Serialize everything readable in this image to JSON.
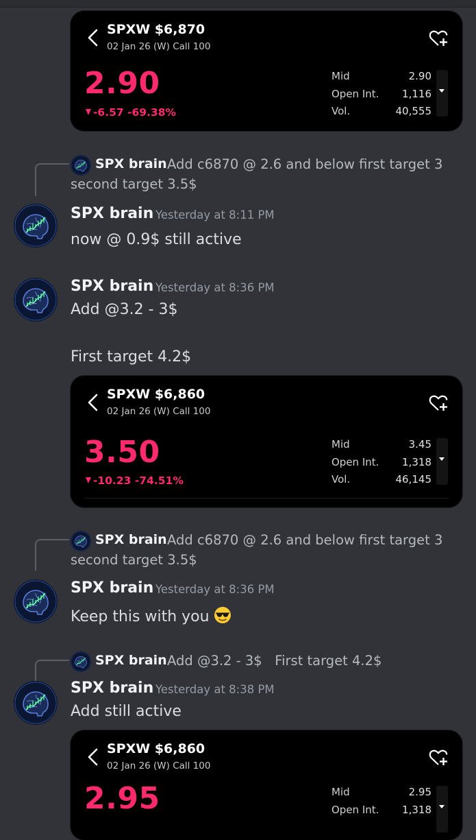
{
  "cards": [
    {
      "ticker": "SPXW $6,870",
      "sub": "02 Jan 26 (W) Call 100",
      "price": "2.90",
      "change": "-6.57 -69.38%",
      "stats": [
        {
          "label": "Mid",
          "value": "2.90"
        },
        {
          "label": "Open Int.",
          "value": "1,116"
        },
        {
          "label": "Vol.",
          "value": "40,555"
        }
      ]
    },
    {
      "ticker": "SPXW $6,860",
      "sub": "02 Jan 26 (W) Call 100",
      "price": "3.50",
      "change": "-10.23 -74.51%",
      "stats": [
        {
          "label": "Mid",
          "value": "3.45"
        },
        {
          "label": "Open Int.",
          "value": "1,318"
        },
        {
          "label": "Vol.",
          "value": "46,145"
        }
      ]
    },
    {
      "ticker": "SPXW $6,860",
      "sub": "02 Jan 26 (W) Call 100",
      "price": "2.95",
      "stats": [
        {
          "label": "Mid",
          "value": "2.95"
        },
        {
          "label": "Open Int.",
          "value": "1,318"
        }
      ]
    }
  ],
  "messages": [
    {
      "reply": {
        "author": "SPX brain",
        "text_line1": "Add c6870 @ 2.6 and below first target 3",
        "text_line2": "second target 3.5$"
      },
      "author": "SPX brain",
      "time": "Yesterday at 8:11 PM",
      "lines": [
        "now @ 0.9$ still active"
      ]
    },
    {
      "author": "SPX brain",
      "time": "Yesterday at 8:36 PM",
      "lines": [
        "Add @3.2 - 3$",
        "First target 4.2$"
      ]
    },
    {
      "reply": {
        "author": "SPX brain",
        "text_line1": "Add c6870 @ 2.6 and below first target 3",
        "text_line2": "second target 3.5$"
      },
      "author": "SPX brain",
      "time": "Yesterday at 8:36 PM",
      "lines": [
        "Keep this with you"
      ],
      "emoji": "sunglasses-emoji"
    },
    {
      "reply": {
        "author": "SPX brain",
        "text_line1": "Add @3.2 - 3$   First target 4.2$"
      },
      "author": "SPX brain",
      "time": "Yesterday at 8:38 PM",
      "lines": [
        "Add still active"
      ]
    }
  ],
  "colors": {
    "background": "#313338",
    "card": "#000000",
    "price_down": "#ff2a6d",
    "muted": "#949ba4"
  }
}
